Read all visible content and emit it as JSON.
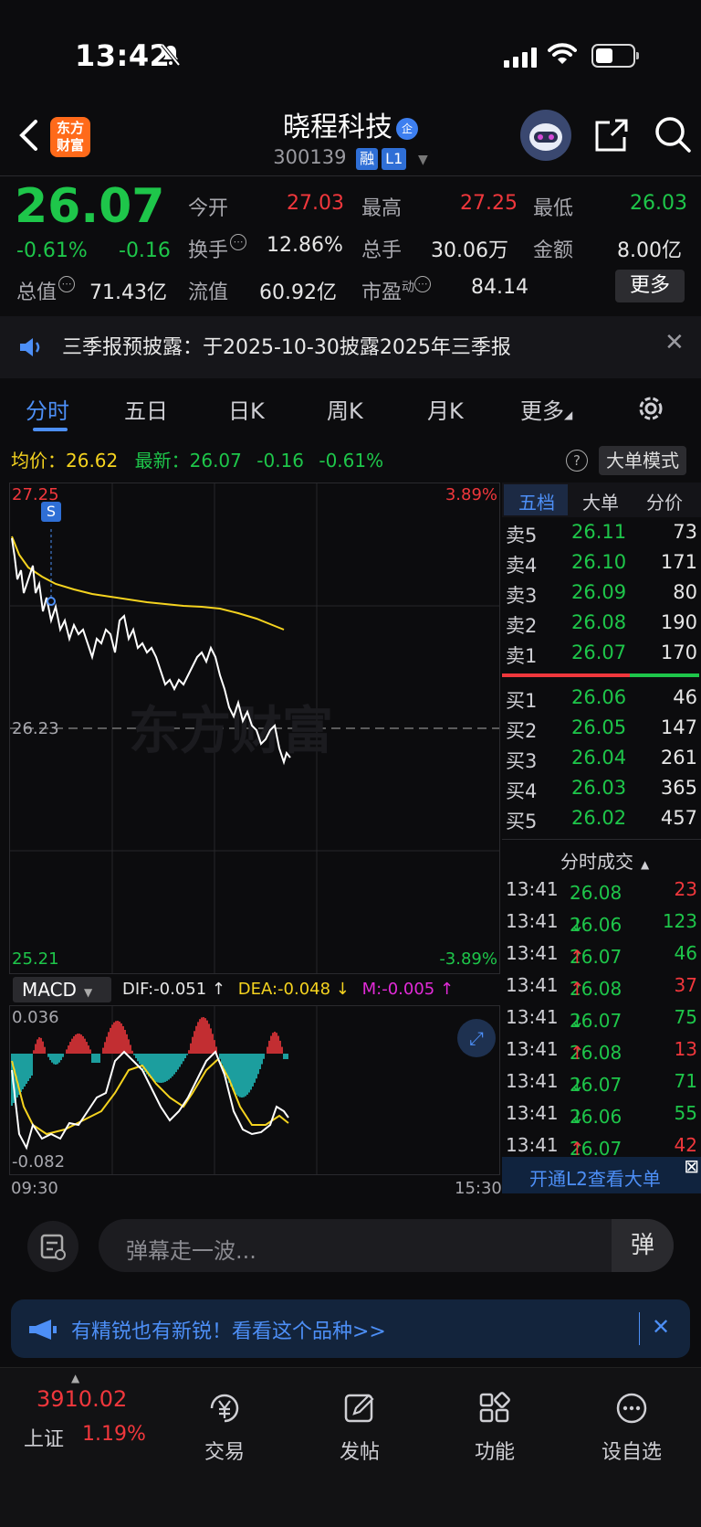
{
  "status_bar": {
    "time": "13:42"
  },
  "header": {
    "back_icon": "chevron-left-icon",
    "logo_line1": "东方",
    "logo_line2": "财富",
    "stock_name": "晓程科技",
    "verified_badge": "企",
    "stock_code": "300139",
    "margin_tag": "融",
    "level_tag": "L1"
  },
  "quote": {
    "price": "26.07",
    "change_pct": "-0.61%",
    "change_amt": "-0.16",
    "open_label": "今开",
    "open": "27.03",
    "high_label": "最高",
    "high": "27.25",
    "low_label": "最低",
    "low": "26.03",
    "turnover_label": "换手",
    "turnover": "12.86%",
    "volume_label": "总手",
    "volume": "30.06万",
    "amount_label": "金额",
    "amount": "8.00亿",
    "mktcap_label": "总值",
    "mktcap": "71.43亿",
    "float_label": "流值",
    "float": "60.92亿",
    "pe_label": "市盈",
    "pe_sup": "动",
    "pe": "84.14",
    "more_label": "更多"
  },
  "notice": {
    "text": "三季报预披露：于2025-10-30披露2025年三季报"
  },
  "tabs": [
    "分时",
    "五日",
    "日K",
    "周K",
    "月K",
    "更多"
  ],
  "intraday": {
    "avg_label": "均价：",
    "avg": "26.62",
    "latest_label": "最新：",
    "latest": "26.07",
    "latest_chg": "-0.16",
    "latest_pct": "-0.61%",
    "mode_btn": "大单模式",
    "y_top": "27.25",
    "y_mid": "26.23",
    "y_bottom": "25.21",
    "pct_top": "3.89%",
    "pct_bottom": "-3.89%",
    "watermark": "东方财富",
    "marker": "S",
    "time_start": "09:30",
    "time_end": "15:30"
  },
  "macd": {
    "select": "MACD",
    "dif": "DIF:-0.051 ↑",
    "dea": "DEA:-0.048 ↓",
    "m": "M:-0.005 ↑",
    "y_top": "0.036",
    "y_bottom": "-0.082"
  },
  "orderbook": {
    "tabs": [
      "五档",
      "大单",
      "分价"
    ],
    "asks": [
      {
        "label": "卖5",
        "price": "26.11",
        "vol": "73"
      },
      {
        "label": "卖4",
        "price": "26.10",
        "vol": "171"
      },
      {
        "label": "卖3",
        "price": "26.09",
        "vol": "80"
      },
      {
        "label": "卖2",
        "price": "26.08",
        "vol": "190"
      },
      {
        "label": "卖1",
        "price": "26.07",
        "vol": "170"
      }
    ],
    "bids": [
      {
        "label": "买1",
        "price": "26.06",
        "vol": "46"
      },
      {
        "label": "买2",
        "price": "26.05",
        "vol": "147"
      },
      {
        "label": "买3",
        "price": "26.04",
        "vol": "261"
      },
      {
        "label": "买4",
        "price": "26.03",
        "vol": "365"
      },
      {
        "label": "买5",
        "price": "26.02",
        "vol": "457"
      }
    ]
  },
  "ticks": {
    "title": "分时成交",
    "rows": [
      {
        "time": "13:41",
        "price": "26.08",
        "arrow": "",
        "vol": "23",
        "dir": "red"
      },
      {
        "time": "13:41",
        "price": "26.06",
        "arrow": "↓",
        "vol": "123",
        "dir": "green"
      },
      {
        "time": "13:41",
        "price": "26.07",
        "arrow": "↑",
        "vol": "46",
        "dir": "green"
      },
      {
        "time": "13:41",
        "price": "26.08",
        "arrow": "↑",
        "vol": "37",
        "dir": "red"
      },
      {
        "time": "13:41",
        "price": "26.07",
        "arrow": "↓",
        "vol": "75",
        "dir": "green"
      },
      {
        "time": "13:41",
        "price": "26.08",
        "arrow": "↑",
        "vol": "13",
        "dir": "red"
      },
      {
        "time": "13:41",
        "price": "26.07",
        "arrow": "↓",
        "vol": "71",
        "dir": "green"
      },
      {
        "time": "13:41",
        "price": "26.06",
        "arrow": "↓",
        "vol": "55",
        "dir": "green"
      },
      {
        "time": "13:41",
        "price": "26.07",
        "arrow": "↑",
        "vol": "42",
        "dir": "red"
      }
    ],
    "l2_text": "开通L2查看大单"
  },
  "danmu": {
    "placeholder": "弹幕走一波...",
    "button": "弹"
  },
  "ad": {
    "text": "有精锐也有新锐！看看这个品种>>"
  },
  "bottom_nav": {
    "index_value": "3910.02",
    "index_name": "上证",
    "index_pct": "1.19%",
    "items": [
      "交易",
      "发帖",
      "功能",
      "设自选"
    ]
  }
}
